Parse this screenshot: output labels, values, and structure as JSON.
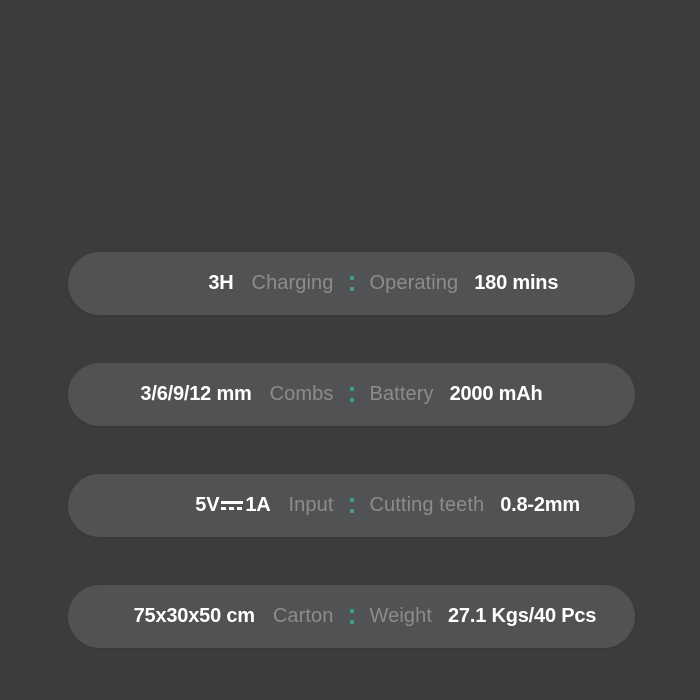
{
  "theme": {
    "page_background": "#3b3c3e",
    "pill_background": "#515254",
    "value_color": "#ffffff",
    "label_color": "#8b8c8e",
    "divider_color": "#3f9f88"
  },
  "spec_rows": [
    {
      "left_value": "3H",
      "left_label": "Charging",
      "divider": "teal-colon-divider",
      "right_label": "Operating",
      "right_value": "180 mins",
      "has_dc_symbol": false
    },
    {
      "left_value": "3/6/9/12 mm",
      "left_label": "Combs",
      "divider": "teal-colon-divider",
      "right_label": "Battery",
      "right_value": "2000 mAh",
      "has_dc_symbol": false
    },
    {
      "left_value_prefix": "5V",
      "left_value_suffix": "1A",
      "left_value": "5V 1A",
      "left_label": "Input",
      "divider": "teal-colon-divider",
      "right_label": "Cutting teeth",
      "right_value": "0.8-2mm",
      "has_dc_symbol": true,
      "dc_symbol_name": "dc-power-icon"
    },
    {
      "left_value": "75x30x50 cm",
      "left_label": "Carton",
      "divider": "teal-colon-divider",
      "right_label": "Weight",
      "right_value": "27.1 Kgs/40 Pcs",
      "has_dc_symbol": false
    }
  ]
}
